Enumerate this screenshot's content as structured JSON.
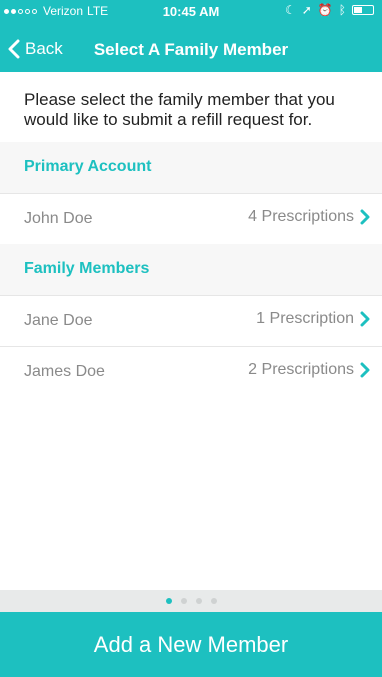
{
  "status_bar": {
    "carrier": "Verizon",
    "network": "LTE",
    "time": "10:45 AM"
  },
  "nav": {
    "back_label": "Back",
    "title": "Select A Family Member"
  },
  "intro_text": "Please select the family member that you would like to submit a refill request for.",
  "primary_account": {
    "label": "Primary Account",
    "members": [
      {
        "name": "John Doe",
        "prescriptions": "4 Prescriptions"
      }
    ]
  },
  "family_members": {
    "label": "Family Members",
    "members": [
      {
        "name": "Jane Doe",
        "prescriptions": "1 Prescription"
      },
      {
        "name": "James Doe",
        "prescriptions": "2 Prescriptions"
      }
    ]
  },
  "pager": {
    "count": 4,
    "active": 0
  },
  "add_button_label": "Add a New Member",
  "colors": {
    "accent": "#1dc0c0",
    "muted_text": "#8a8a8a",
    "section_bg": "#f7f7f7"
  }
}
